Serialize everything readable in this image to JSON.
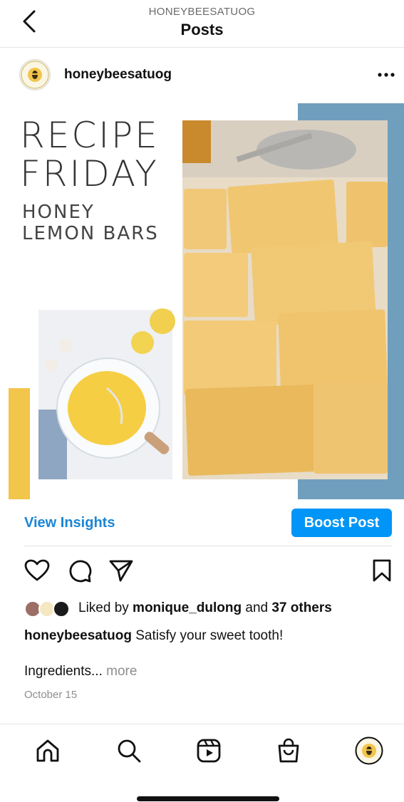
{
  "header": {
    "account": "HONEYBEESATUOG",
    "title": "Posts"
  },
  "post": {
    "username": "honeybeesatuog",
    "image_text": {
      "line1": "RECIPE",
      "line2": "FRIDAY",
      "line3": "HONEY",
      "line4": "LEMON BARS"
    },
    "view_insights": "View Insights",
    "boost_post": "Boost Post",
    "liked_by_prefix": "Liked by ",
    "liked_by_user": "monique_dulong",
    "liked_by_mid": " and ",
    "liked_by_others": "37 others",
    "caption_user": "honeybeesatuog",
    "caption_text": " Satisfy your sweet tooth!",
    "ingredients": "Ingredients...",
    "more": "more",
    "date": "October 15"
  },
  "colors": {
    "accent": "#0095f6",
    "link": "#1a86d6",
    "muted": "#8e8e8e",
    "image_blue_panel": "#6f9fbd",
    "image_yellow_bar": "#f2c54b"
  },
  "icons": {
    "back": "chevron-left-icon",
    "options": "more-dots-icon",
    "like": "heart-icon",
    "comment": "comment-icon",
    "share": "paper-plane-icon",
    "save": "bookmark-icon",
    "nav": [
      "home-icon",
      "search-icon",
      "reels-icon",
      "shop-icon",
      "profile-avatar"
    ]
  }
}
